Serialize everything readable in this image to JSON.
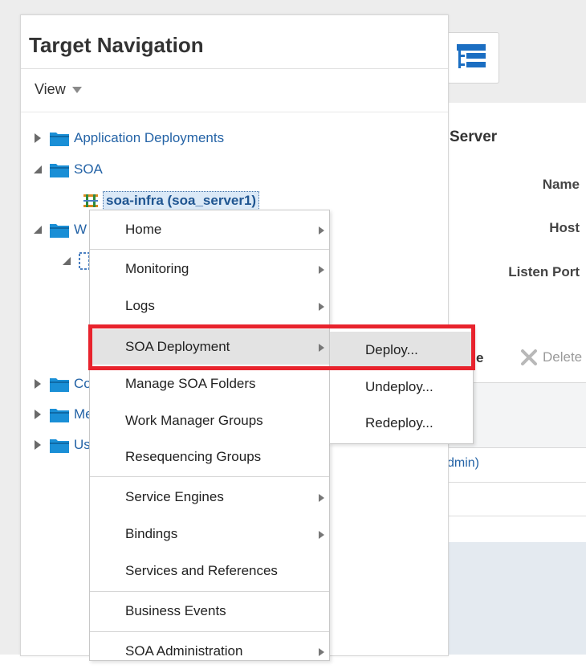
{
  "nav": {
    "title": "Target Navigation",
    "view_label": "View",
    "tree": [
      {
        "label": "Application Deployments",
        "state": "collapsed"
      },
      {
        "label": "SOA",
        "state": "expanded"
      },
      {
        "label": "soa-infra (soa_server1)",
        "state": "selected"
      },
      {
        "label": "W",
        "state": "expanded"
      },
      {
        "label": "Co",
        "state": "collapsed"
      },
      {
        "label": "Me",
        "state": "collapsed"
      },
      {
        "label": "Us",
        "state": "collapsed"
      }
    ]
  },
  "menu": {
    "items": [
      {
        "label": "Home"
      },
      {
        "label": "Monitoring"
      },
      {
        "label": "Logs"
      },
      {
        "label": "SOA Deployment"
      },
      {
        "label": "Manage SOA Folders"
      },
      {
        "label": "Work Manager Groups"
      },
      {
        "label": "Resequencing Groups"
      },
      {
        "label": "Service Engines"
      },
      {
        "label": "Bindings"
      },
      {
        "label": "Services and References"
      },
      {
        "label": "Business Events"
      },
      {
        "label": "SOA Administration"
      }
    ]
  },
  "submenu": {
    "items": [
      {
        "label": "Deploy..."
      },
      {
        "label": "Undeploy..."
      },
      {
        "label": "Redeploy..."
      }
    ]
  },
  "server": {
    "title": "Server",
    "name_label": "Name",
    "host_label": "Host",
    "port_label": "Listen Port",
    "toolbar_partial": "e",
    "delete_label": "Delete",
    "admin_partial": "dmin)"
  },
  "colors": {
    "link": "#2463a6",
    "folder": "#1a8fd6",
    "highlight_box": "#e8232d"
  }
}
